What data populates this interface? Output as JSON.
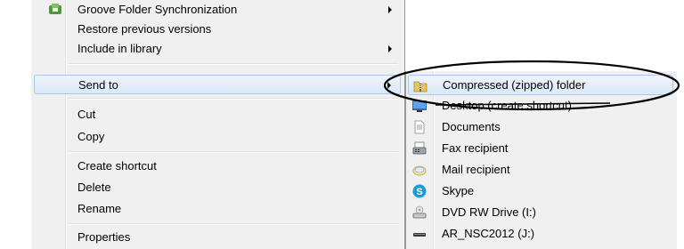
{
  "context_menu": {
    "items": [
      {
        "label": "Groove Folder Synchronization",
        "icon": "groove-icon",
        "has_submenu": true
      },
      {
        "label": "Restore previous versions",
        "has_submenu": false
      },
      {
        "label": "Include in library",
        "has_submenu": true
      },
      {
        "label": "Send to",
        "has_submenu": true,
        "highlighted": true
      },
      {
        "label": "Cut"
      },
      {
        "label": "Copy"
      },
      {
        "label": "Create shortcut"
      },
      {
        "label": "Delete"
      },
      {
        "label": "Rename"
      },
      {
        "label": "Properties"
      }
    ]
  },
  "send_to_menu": {
    "items": [
      {
        "label": "Compressed (zipped) folder",
        "icon": "zip-folder-icon",
        "highlighted": true
      },
      {
        "label": "Desktop (create shortcut)",
        "icon": "desktop-icon",
        "struck_through": true
      },
      {
        "label": "Documents",
        "icon": "documents-icon"
      },
      {
        "label": "Fax recipient",
        "icon": "fax-icon"
      },
      {
        "label": "Mail recipient",
        "icon": "mail-icon"
      },
      {
        "label": "Skype",
        "icon": "skype-icon"
      },
      {
        "label": "DVD RW Drive (I:)",
        "icon": "dvd-drive-icon"
      },
      {
        "label": "AR_NSC2012 (J:)",
        "icon": "usb-drive-icon"
      }
    ]
  },
  "colors": {
    "menu_bg": "#f0f0f0",
    "highlight_border": "#a8c8ec",
    "highlight_bg": "#dbe8f7",
    "annotation": "#000000"
  }
}
